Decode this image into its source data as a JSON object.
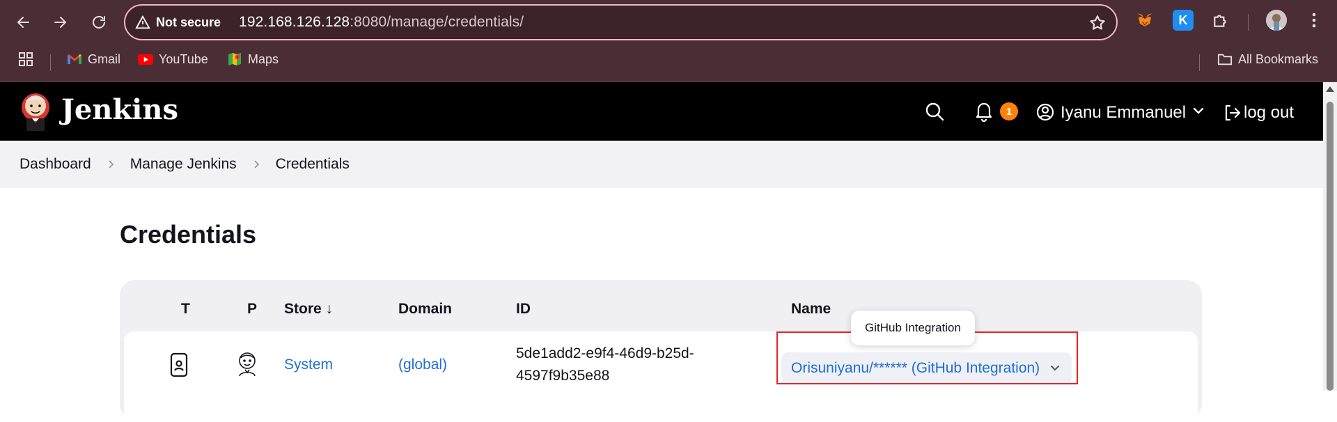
{
  "browser": {
    "security_label": "Not secure",
    "url_host": "192.168.126.128",
    "url_rest": ":8080/manage/credentials/",
    "bookmarks": [
      {
        "label": "Gmail",
        "icon": "gmail-icon"
      },
      {
        "label": "YouTube",
        "icon": "youtube-icon"
      },
      {
        "label": "Maps",
        "icon": "maps-icon"
      }
    ],
    "all_bookmarks_label": "All Bookmarks"
  },
  "header": {
    "title": "Jenkins",
    "notification_count": "1",
    "user_name": "Iyanu Emmanuel",
    "logout_label": "log out"
  },
  "breadcrumb": {
    "items": [
      "Dashboard",
      "Manage Jenkins",
      "Credentials"
    ]
  },
  "main": {
    "title": "Credentials",
    "table": {
      "headers": {
        "t": "T",
        "p": "P",
        "store": "Store ↓",
        "domain": "Domain",
        "id": "ID",
        "name": "Name"
      },
      "rows": [
        {
          "store": "System",
          "domain": "(global)",
          "id_line1": "5de1add2-e9f4-46d9-b25d-",
          "id_line2": "4597f9b35e88",
          "name": "Orisuniyanu/****** (GitHub Integration)"
        }
      ]
    },
    "tooltip": "GitHub Integration"
  },
  "colors": {
    "chrome": "#4b2d35",
    "link": "#1f6ed4",
    "badge": "#fe820a",
    "highlight": "#e3242b"
  }
}
